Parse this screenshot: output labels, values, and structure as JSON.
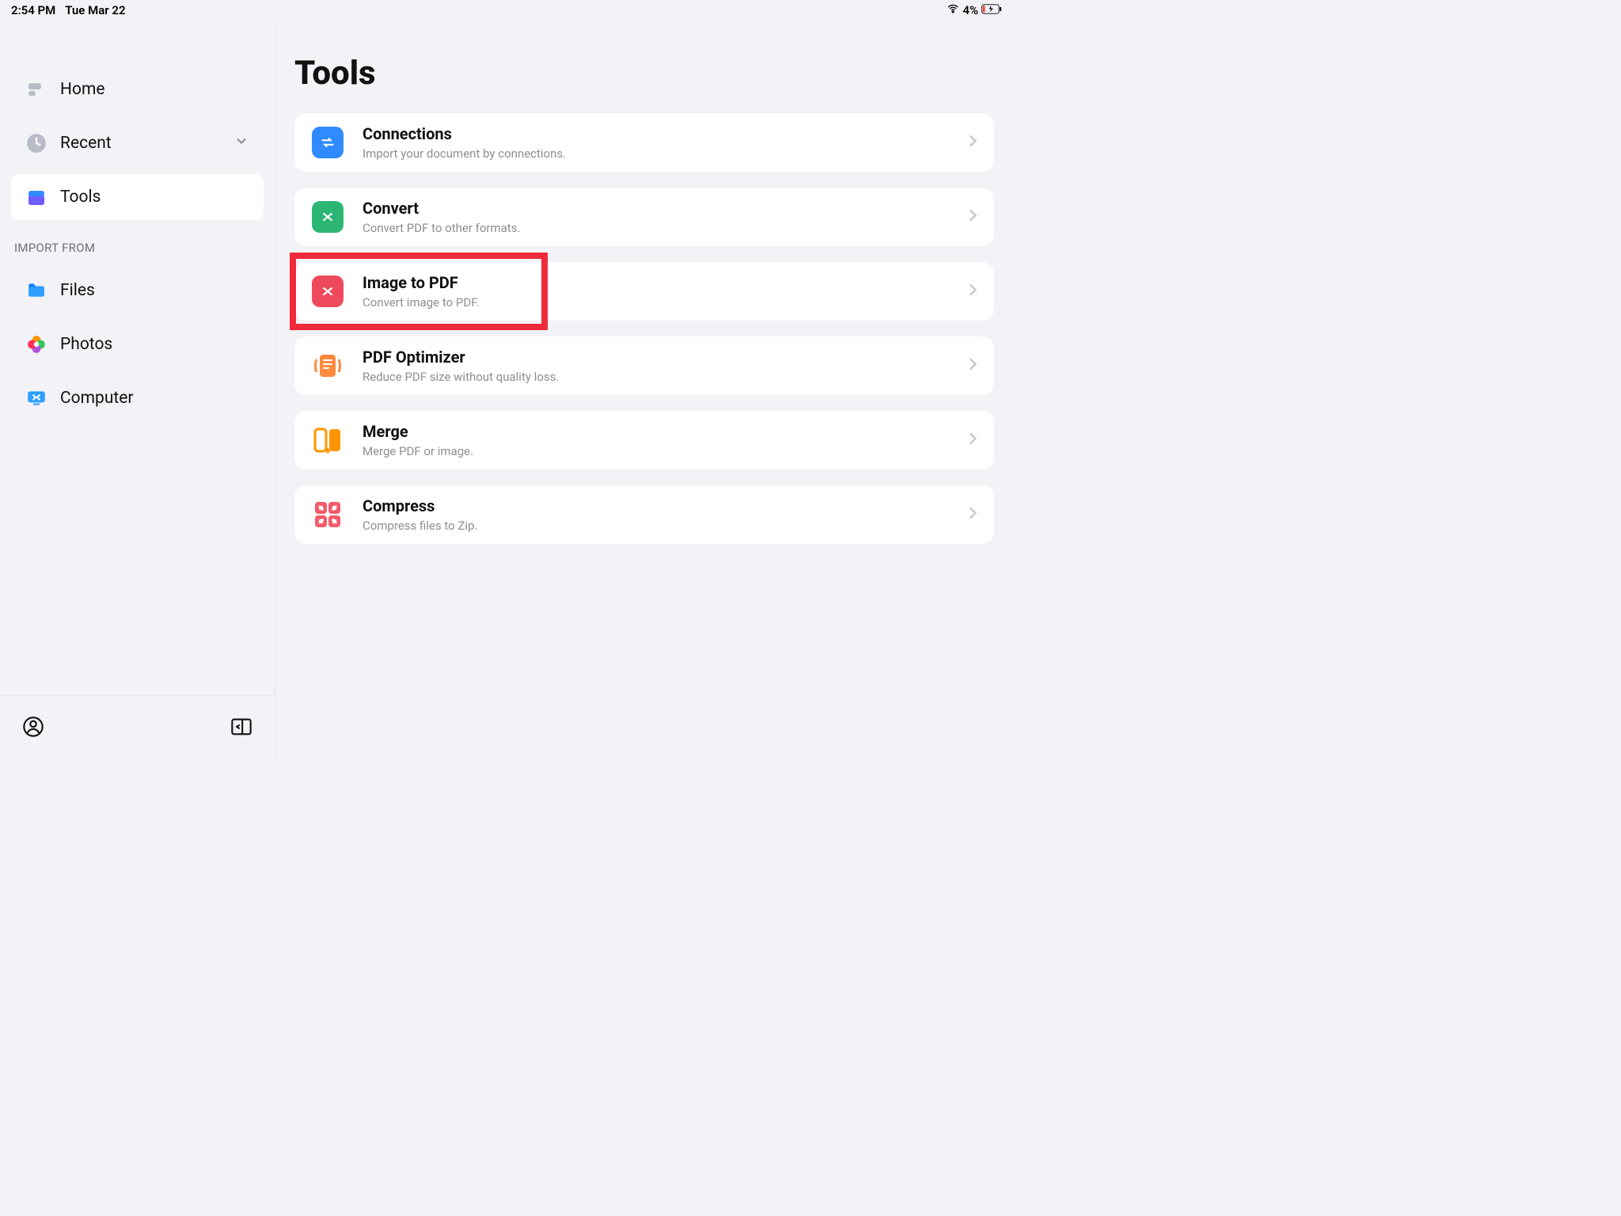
{
  "statusbar": {
    "time": "2:54 PM",
    "date": "Tue Mar 22",
    "battery": "4%"
  },
  "sidebar": {
    "items": [
      {
        "label": "Home"
      },
      {
        "label": "Recent"
      },
      {
        "label": "Tools"
      }
    ],
    "section_header": "IMPORT FROM",
    "import_items": [
      {
        "label": "Files"
      },
      {
        "label": "Photos"
      },
      {
        "label": "Computer"
      }
    ]
  },
  "main": {
    "title": "Tools",
    "tools": [
      {
        "title": "Connections",
        "sub": "Import your document by connections."
      },
      {
        "title": "Convert",
        "sub": "Convert PDF to other formats."
      },
      {
        "title": "Image to PDF",
        "sub": "Convert image to PDF."
      },
      {
        "title": "PDF Optimizer",
        "sub": "Reduce PDF size without quality loss."
      },
      {
        "title": "Merge",
        "sub": "Merge PDF or image."
      },
      {
        "title": "Compress",
        "sub": "Compress files to Zip."
      }
    ]
  }
}
